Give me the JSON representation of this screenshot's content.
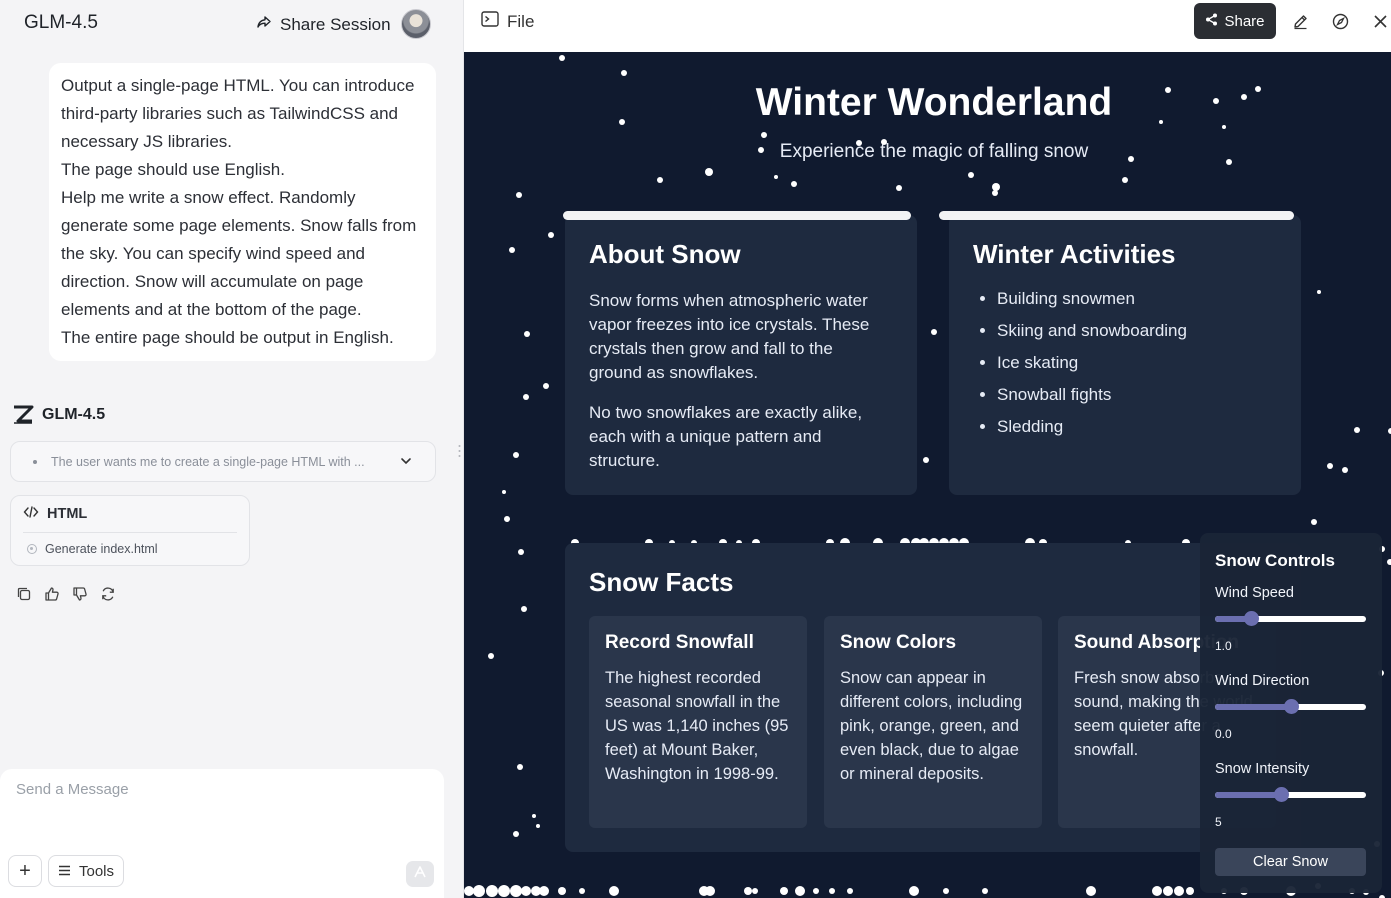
{
  "chat": {
    "app_title": "GLM-4.5",
    "share_session_label": "Share Session",
    "user_message": [
      "Output a single-page HTML. You can introduce third-party libraries such as TailwindCSS and necessary JS libraries.",
      "The page should use English.",
      "Help me write a snow effect. Randomly generate some page elements. Snow falls from the sky. You can specify wind speed and direction. Snow will accumulate on page elements and at the bottom of the page.",
      "The entire page should be output in English."
    ],
    "model_name": "GLM-4.5",
    "thinking_summary": "The user wants me to create a single-page HTML with ...",
    "artifact": {
      "type_label": "HTML",
      "step_label": "Generate index.html"
    },
    "composer": {
      "placeholder": "Send a Message",
      "tools_label": "Tools",
      "plus_label": "+"
    }
  },
  "preview": {
    "file_tab_label": "File",
    "share_label": "Share",
    "page": {
      "title": "Winter Wonderland",
      "subtitle": "Experience the magic of falling snow",
      "about": {
        "heading": "About Snow",
        "paragraphs": [
          "Snow forms when atmospheric water vapor freezes into ice crystals. These crystals then grow and fall to the ground as snowflakes.",
          "No two snowflakes are exactly alike, each with a unique pattern and structure."
        ]
      },
      "activities": {
        "heading": "Winter Activities",
        "items": [
          "Building snowmen",
          "Skiing and snowboarding",
          "Ice skating",
          "Snowball fights",
          "Sledding"
        ]
      },
      "facts": {
        "heading": "Snow Facts",
        "cards": [
          {
            "title": "Record Snowfall",
            "text": "The highest recorded seasonal snowfall in the US was 1,140 inches (95 feet) at Mount Baker, Washington in 1998-99."
          },
          {
            "title": "Snow Colors",
            "text": "Snow can appear in different colors, including pink, orange, green, and even black, due to algae or mineral deposits."
          },
          {
            "title": "Sound Absorption",
            "text": "Fresh snow absorbs sound, making the world seem quieter after a snowfall."
          }
        ]
      },
      "controls": {
        "heading": "Snow Controls",
        "wind_speed_label": "Wind Speed",
        "wind_speed_value": "1.0",
        "wind_speed_fraction": 0.24,
        "wind_direction_label": "Wind Direction",
        "wind_direction_value": "0.0",
        "wind_direction_fraction": 0.5,
        "intensity_label": "Snow Intensity",
        "intensity_value": "5",
        "intensity_fraction": 0.44,
        "clear_label": "Clear Snow"
      }
    }
  },
  "colors": {
    "stage_bg": "#101a2f",
    "card_bg": "#1e2a3f",
    "fact_bg": "#2a364b",
    "slider_accent": "#6b6fb0",
    "share_btn_bg": "#2b2e33"
  }
}
